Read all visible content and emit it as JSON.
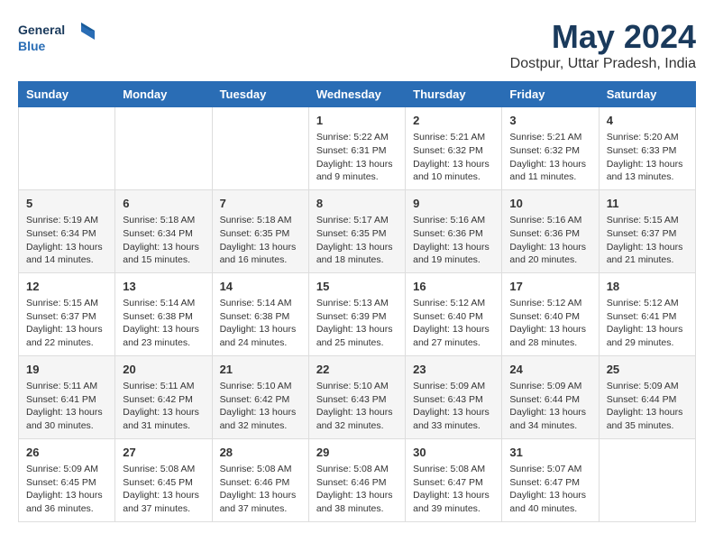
{
  "logo": {
    "line1": "General",
    "line2": "Blue"
  },
  "title": "May 2024",
  "subtitle": "Dostpur, Uttar Pradesh, India",
  "headers": [
    "Sunday",
    "Monday",
    "Tuesday",
    "Wednesday",
    "Thursday",
    "Friday",
    "Saturday"
  ],
  "weeks": [
    [
      {
        "day": "",
        "info": ""
      },
      {
        "day": "",
        "info": ""
      },
      {
        "day": "",
        "info": ""
      },
      {
        "day": "1",
        "info": "Sunrise: 5:22 AM\nSunset: 6:31 PM\nDaylight: 13 hours\nand 9 minutes."
      },
      {
        "day": "2",
        "info": "Sunrise: 5:21 AM\nSunset: 6:32 PM\nDaylight: 13 hours\nand 10 minutes."
      },
      {
        "day": "3",
        "info": "Sunrise: 5:21 AM\nSunset: 6:32 PM\nDaylight: 13 hours\nand 11 minutes."
      },
      {
        "day": "4",
        "info": "Sunrise: 5:20 AM\nSunset: 6:33 PM\nDaylight: 13 hours\nand 13 minutes."
      }
    ],
    [
      {
        "day": "5",
        "info": "Sunrise: 5:19 AM\nSunset: 6:34 PM\nDaylight: 13 hours\nand 14 minutes."
      },
      {
        "day": "6",
        "info": "Sunrise: 5:18 AM\nSunset: 6:34 PM\nDaylight: 13 hours\nand 15 minutes."
      },
      {
        "day": "7",
        "info": "Sunrise: 5:18 AM\nSunset: 6:35 PM\nDaylight: 13 hours\nand 16 minutes."
      },
      {
        "day": "8",
        "info": "Sunrise: 5:17 AM\nSunset: 6:35 PM\nDaylight: 13 hours\nand 18 minutes."
      },
      {
        "day": "9",
        "info": "Sunrise: 5:16 AM\nSunset: 6:36 PM\nDaylight: 13 hours\nand 19 minutes."
      },
      {
        "day": "10",
        "info": "Sunrise: 5:16 AM\nSunset: 6:36 PM\nDaylight: 13 hours\nand 20 minutes."
      },
      {
        "day": "11",
        "info": "Sunrise: 5:15 AM\nSunset: 6:37 PM\nDaylight: 13 hours\nand 21 minutes."
      }
    ],
    [
      {
        "day": "12",
        "info": "Sunrise: 5:15 AM\nSunset: 6:37 PM\nDaylight: 13 hours\nand 22 minutes."
      },
      {
        "day": "13",
        "info": "Sunrise: 5:14 AM\nSunset: 6:38 PM\nDaylight: 13 hours\nand 23 minutes."
      },
      {
        "day": "14",
        "info": "Sunrise: 5:14 AM\nSunset: 6:38 PM\nDaylight: 13 hours\nand 24 minutes."
      },
      {
        "day": "15",
        "info": "Sunrise: 5:13 AM\nSunset: 6:39 PM\nDaylight: 13 hours\nand 25 minutes."
      },
      {
        "day": "16",
        "info": "Sunrise: 5:12 AM\nSunset: 6:40 PM\nDaylight: 13 hours\nand 27 minutes."
      },
      {
        "day": "17",
        "info": "Sunrise: 5:12 AM\nSunset: 6:40 PM\nDaylight: 13 hours\nand 28 minutes."
      },
      {
        "day": "18",
        "info": "Sunrise: 5:12 AM\nSunset: 6:41 PM\nDaylight: 13 hours\nand 29 minutes."
      }
    ],
    [
      {
        "day": "19",
        "info": "Sunrise: 5:11 AM\nSunset: 6:41 PM\nDaylight: 13 hours\nand 30 minutes."
      },
      {
        "day": "20",
        "info": "Sunrise: 5:11 AM\nSunset: 6:42 PM\nDaylight: 13 hours\nand 31 minutes."
      },
      {
        "day": "21",
        "info": "Sunrise: 5:10 AM\nSunset: 6:42 PM\nDaylight: 13 hours\nand 32 minutes."
      },
      {
        "day": "22",
        "info": "Sunrise: 5:10 AM\nSunset: 6:43 PM\nDaylight: 13 hours\nand 32 minutes."
      },
      {
        "day": "23",
        "info": "Sunrise: 5:09 AM\nSunset: 6:43 PM\nDaylight: 13 hours\nand 33 minutes."
      },
      {
        "day": "24",
        "info": "Sunrise: 5:09 AM\nSunset: 6:44 PM\nDaylight: 13 hours\nand 34 minutes."
      },
      {
        "day": "25",
        "info": "Sunrise: 5:09 AM\nSunset: 6:44 PM\nDaylight: 13 hours\nand 35 minutes."
      }
    ],
    [
      {
        "day": "26",
        "info": "Sunrise: 5:09 AM\nSunset: 6:45 PM\nDaylight: 13 hours\nand 36 minutes."
      },
      {
        "day": "27",
        "info": "Sunrise: 5:08 AM\nSunset: 6:45 PM\nDaylight: 13 hours\nand 37 minutes."
      },
      {
        "day": "28",
        "info": "Sunrise: 5:08 AM\nSunset: 6:46 PM\nDaylight: 13 hours\nand 37 minutes."
      },
      {
        "day": "29",
        "info": "Sunrise: 5:08 AM\nSunset: 6:46 PM\nDaylight: 13 hours\nand 38 minutes."
      },
      {
        "day": "30",
        "info": "Sunrise: 5:08 AM\nSunset: 6:47 PM\nDaylight: 13 hours\nand 39 minutes."
      },
      {
        "day": "31",
        "info": "Sunrise: 5:07 AM\nSunset: 6:47 PM\nDaylight: 13 hours\nand 40 minutes."
      },
      {
        "day": "",
        "info": ""
      }
    ]
  ]
}
